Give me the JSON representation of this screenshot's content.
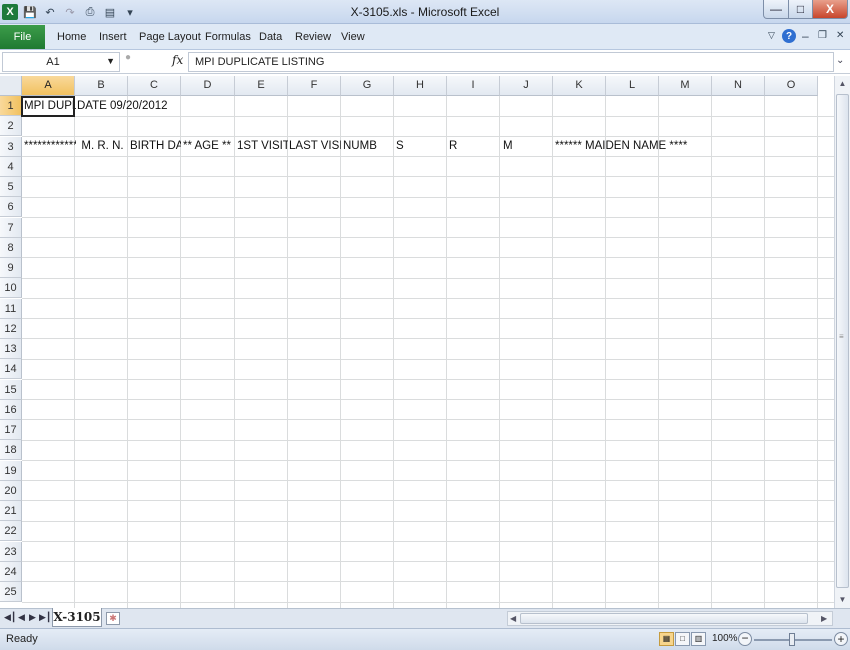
{
  "window": {
    "title": "X-3105.xls  -  Microsoft Excel",
    "app_icon": "X",
    "minimize": "—",
    "maximize": "□",
    "close": "X"
  },
  "ribbon": {
    "file": "File",
    "tabs": [
      "Home",
      "Insert",
      "Page Layout",
      "Formulas",
      "Data",
      "Review",
      "View"
    ]
  },
  "formula_bar": {
    "name_box": "A1",
    "fx": "fx",
    "value": "MPI DUPLICATE LISTING"
  },
  "grid": {
    "columns": [
      "A",
      "B",
      "C",
      "D",
      "E",
      "F",
      "G",
      "H",
      "I",
      "J",
      "K",
      "L",
      "M",
      "N",
      "O"
    ],
    "rows": [
      "1",
      "2",
      "3",
      "4",
      "5",
      "6",
      "7",
      "8",
      "9",
      "10",
      "11",
      "12",
      "13",
      "14",
      "15",
      "16",
      "17",
      "18",
      "19",
      "20",
      "21",
      "22",
      "23",
      "24",
      "25"
    ],
    "cells": {
      "A1": "MPI DUPLICATE LISTING",
      "B1": "DATE 09/20/2012",
      "A3": "************",
      "B3": "M. R. N.",
      "C3": "BIRTH DATE",
      "D3": "** AGE **",
      "E3": "1ST VISIT",
      "F3": "LAST VISIT",
      "G3": "NUMB",
      "H3": "S",
      "I3": "R",
      "J3": "M",
      "K3": "****** MAIDEN NAME ****"
    }
  },
  "sheets": {
    "active": "X-3105"
  },
  "status": {
    "text": "Ready",
    "zoom": "100%"
  }
}
